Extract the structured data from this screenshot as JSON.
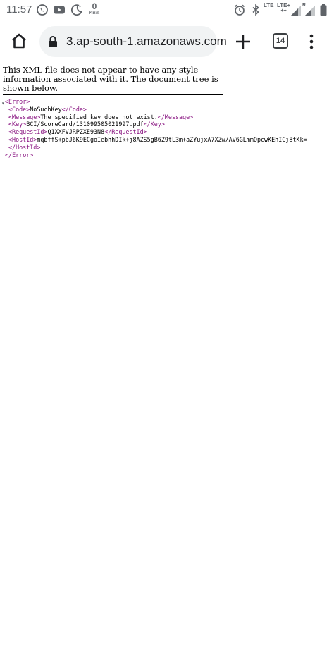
{
  "status_bar": {
    "time": "11:57",
    "net_speed_value": "0",
    "net_speed_unit": "KB/s",
    "lte1": "LTE",
    "lte2": "LTE+",
    "lte2_sub": "++",
    "roaming": "R",
    "icons": [
      "whatsapp-icon",
      "youtube-icon",
      "night-mode-icon",
      "alarm-icon",
      "bluetooth-icon",
      "signal-icon",
      "signal-icon",
      "battery-icon"
    ]
  },
  "browser": {
    "url": "3.ap-south-1.amazonaws.com",
    "tab_count": "14",
    "icons": [
      "home-icon",
      "lock-icon",
      "plus-icon",
      "tab-switcher-icon",
      "more-vert-icon"
    ]
  },
  "page": {
    "info_text": "This XML file does not appear to have any style information associated with it. The document tree is shown below.",
    "collapse_marker": "▾",
    "error_open": "<Error>",
    "error_close": "</Error>",
    "code_open": "<Code>",
    "code_value": "NoSuchKey",
    "code_close": "</Code>",
    "message_open": "<Message>",
    "message_value": "The specified key does not exist.",
    "message_close": "</Message>",
    "key_open": "<Key>",
    "key_value": "BCI/ScoreCard/131099505021997.pdf",
    "key_close": "</Key>",
    "requestid_open": "<RequestId>",
    "requestid_value": "Q1XXFVJRPZXE93N8",
    "requestid_close": "</RequestId>",
    "hostid_open": "<HostId>",
    "hostid_value": "mqbffS+pbJ6K9ECgoIebhhDIk+j8AZS5gB6Z9tL3m+aZYujxA7XZw/AV6GLmmOpcwKEhICj8tKk=",
    "hostid_close": "</HostId>"
  },
  "colors": {
    "xml_tag": "#881280",
    "omnibox_bg": "#f1f3f4",
    "status_icon": "#5f6368"
  }
}
